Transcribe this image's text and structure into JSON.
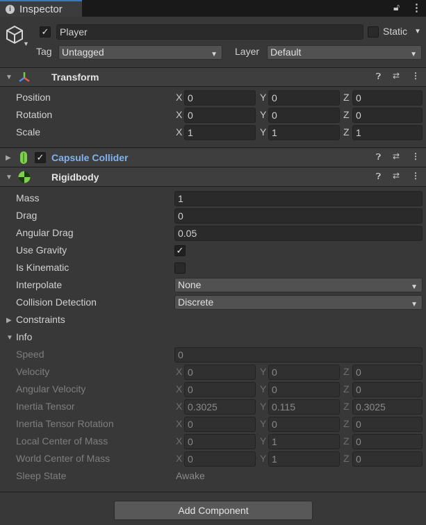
{
  "tab": {
    "title": "Inspector"
  },
  "gameobject": {
    "name": "Player",
    "static_label": "Static",
    "tag_label": "Tag",
    "tag_value": "Untagged",
    "layer_label": "Layer",
    "layer_value": "Default"
  },
  "transform": {
    "title": "Transform",
    "rows": [
      {
        "label": "Position",
        "x": "0",
        "y": "0",
        "z": "0"
      },
      {
        "label": "Rotation",
        "x": "0",
        "y": "0",
        "z": "0"
      },
      {
        "label": "Scale",
        "x": "1",
        "y": "1",
        "z": "1"
      }
    ]
  },
  "capsule_collider": {
    "title": "Capsule Collider"
  },
  "rigidbody": {
    "title": "Rigidbody",
    "mass_label": "Mass",
    "mass": "1",
    "drag_label": "Drag",
    "drag": "0",
    "angular_drag_label": "Angular Drag",
    "angular_drag": "0.05",
    "use_gravity_label": "Use Gravity",
    "is_kinematic_label": "Is Kinematic",
    "interpolate_label": "Interpolate",
    "interpolate": "None",
    "collision_label": "Collision Detection",
    "collision": "Discrete",
    "constraints_label": "Constraints",
    "info_label": "Info",
    "speed_label": "Speed",
    "speed": "0",
    "info_rows": [
      {
        "label": "Velocity",
        "x": "0",
        "y": "0",
        "z": "0"
      },
      {
        "label": "Angular Velocity",
        "x": "0",
        "y": "0",
        "z": "0"
      },
      {
        "label": "Inertia Tensor",
        "x": "0.3025",
        "y": "0.115",
        "z": "0.3025"
      },
      {
        "label": "Inertia Tensor Rotation",
        "x": "0",
        "y": "0",
        "z": "0"
      },
      {
        "label": "Local Center of Mass",
        "x": "0",
        "y": "1",
        "z": "0"
      },
      {
        "label": "World Center of Mass",
        "x": "0",
        "y": "1",
        "z": "0"
      }
    ],
    "sleep_label": "Sleep State",
    "sleep": "Awake"
  },
  "axes": {
    "x": "X",
    "y": "Y",
    "z": "Z"
  },
  "add_component": "Add Component",
  "colors": {
    "accent": "#3a79bb",
    "collider_title": "#7fb2f0"
  }
}
